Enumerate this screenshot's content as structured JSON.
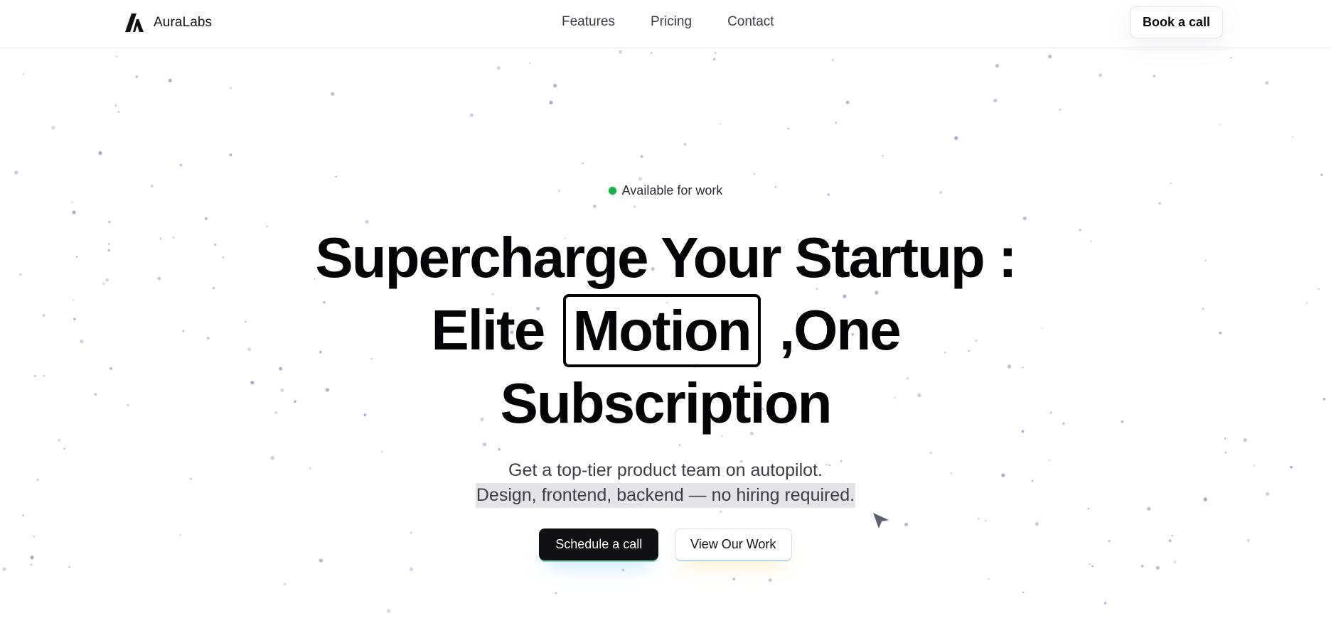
{
  "nav": {
    "brand_name": "AuraLabs",
    "links": [
      "Features",
      "Pricing",
      "Contact"
    ],
    "cta_label": "Book a call"
  },
  "hero": {
    "status_text": "Available for work",
    "status_color": "#16b24a",
    "headline_line1": "Supercharge Your Startup :",
    "headline_line2_before": "Elite",
    "headline_highlight": "Motion",
    "headline_line2_after": ",One",
    "headline_line3": "Subscription",
    "subtitle_line1": "Get a top-tier product team on autopilot.",
    "subtitle_line2": "Design, frontend, backend — no hiring required.",
    "primary_cta": "Schedule a call",
    "secondary_cta": "View Our Work"
  },
  "colors": {
    "dot": "#9a9ac4",
    "text_dark": "#050507",
    "accent_glow": "#7bdcb5"
  }
}
